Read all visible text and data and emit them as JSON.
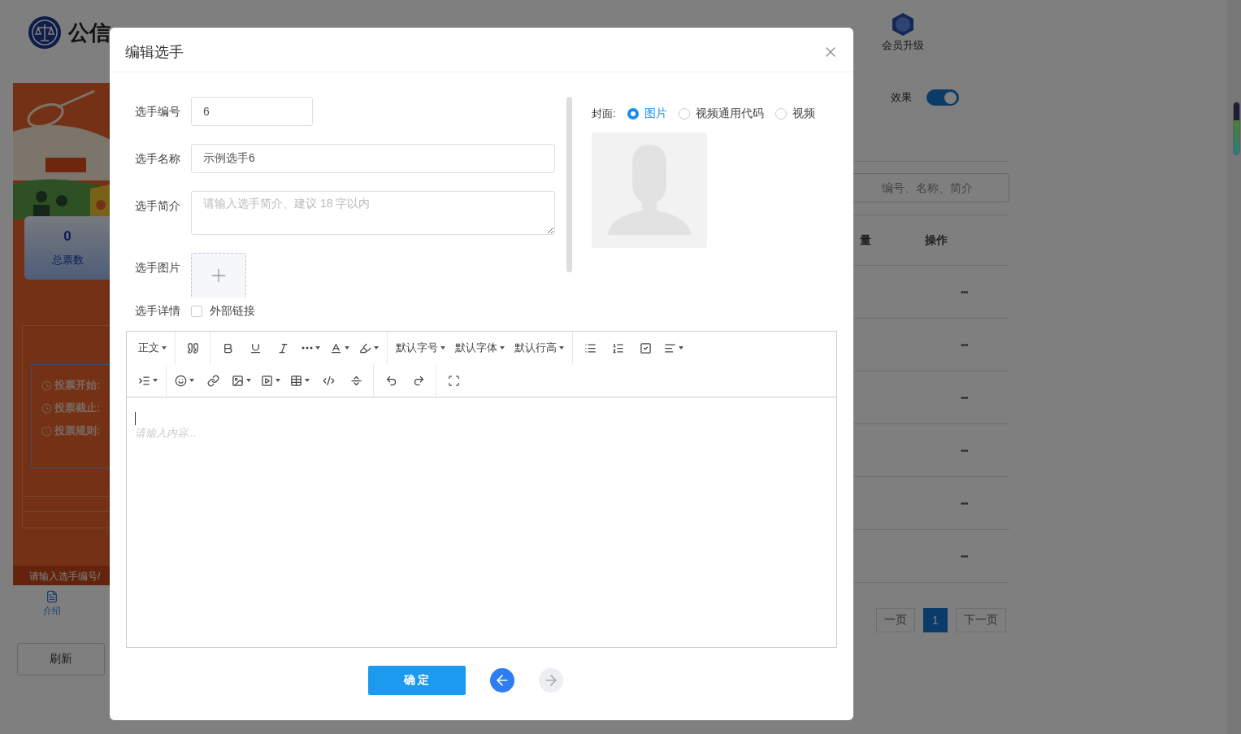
{
  "header": {
    "logo_text": "公信",
    "vip_label": "会员升级"
  },
  "preview": {
    "total_votes": "0",
    "total_votes_label": "总票数",
    "info": [
      {
        "label": "投票开始:"
      },
      {
        "label": "投票截止:"
      },
      {
        "label": "投票规则:"
      }
    ],
    "search_placeholder": "请输入选手编号/",
    "tab": "介绍",
    "refresh": "刷新"
  },
  "list_panel": {
    "toggle_label": "效果",
    "toggle_on": true,
    "search_placeholder": "编号、名称、简介",
    "columns": [
      "量",
      "操作"
    ],
    "rows": [
      {
        "action": "•••"
      },
      {
        "action": "•••"
      },
      {
        "action": "•••"
      },
      {
        "action": "•••"
      },
      {
        "action": "•••"
      },
      {
        "action": "•••"
      }
    ],
    "pagination": {
      "prev": "一页",
      "pages": [
        {
          "label": "1",
          "selected": true
        }
      ],
      "next": "下一页"
    }
  },
  "dialog": {
    "title": "编辑选手",
    "fields": [
      {
        "kind": "input",
        "label": "选手编号",
        "value": "6"
      },
      {
        "kind": "input",
        "label": "选手名称",
        "value": "示例选手6"
      },
      {
        "kind": "textarea",
        "label": "选手简介",
        "placeholder": "请输入选手简介、建议 18 字以内"
      },
      {
        "kind": "upload",
        "label": "选手图片"
      },
      {
        "kind": "checkbox",
        "label": "选手详情",
        "option": "外部链接",
        "checked": false
      }
    ],
    "cover": {
      "label": "封面:",
      "options": [
        {
          "label": "图片",
          "selected": true
        },
        {
          "label": "视频通用代码",
          "selected": false
        },
        {
          "label": "视频",
          "selected": false
        }
      ]
    },
    "editor": {
      "toolbar_labels": [
        "正文",
        "默认字号",
        "默认字体",
        "默认行高"
      ],
      "placeholder": "请输入内容..."
    },
    "confirm": "确 定",
    "nav": [
      {
        "kind": "prev",
        "disabled": false
      },
      {
        "kind": "next",
        "disabled": true
      }
    ]
  }
}
